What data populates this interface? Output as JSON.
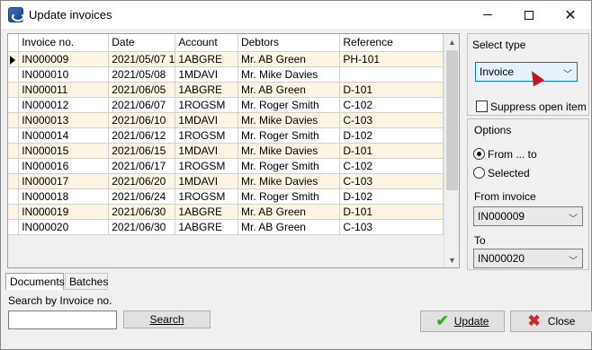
{
  "window": {
    "title": "Update invoices"
  },
  "grid": {
    "columns": [
      "Invoice no.",
      "Date",
      "Account",
      "Debtors",
      "Reference"
    ],
    "rows": [
      [
        "IN000009",
        "2021/05/07 1",
        "1ABGRE",
        "Mr. AB Green",
        "PH-101"
      ],
      [
        "IN000010",
        "2021/05/08",
        "1MDAVI",
        "Mr. Mike Davies",
        ""
      ],
      [
        "IN000011",
        "2021/06/05",
        "1ABGRE",
        "Mr. AB Green",
        "D-101"
      ],
      [
        "IN000012",
        "2021/06/07",
        "1ROGSM",
        "Mr. Roger Smith",
        "C-102"
      ],
      [
        "IN000013",
        "2021/06/10",
        "1MDAVI",
        "Mr. Mike Davies",
        "C-103"
      ],
      [
        "IN000014",
        "2021/06/12",
        "1ROGSM",
        "Mr. Roger Smith",
        "D-102"
      ],
      [
        "IN000015",
        "2021/06/15",
        "1MDAVI",
        "Mr. Mike Davies",
        "D-101"
      ],
      [
        "IN000016",
        "2021/06/17",
        "1ROGSM",
        "Mr. Roger Smith",
        "C-102"
      ],
      [
        "IN000017",
        "2021/06/20",
        "1MDAVI",
        "Mr. Mike Davies",
        "C-103"
      ],
      [
        "IN000018",
        "2021/06/24",
        "1ROGSM",
        "Mr. Roger Smith",
        "D-102"
      ],
      [
        "IN000019",
        "2021/06/30",
        "1ABGRE",
        "Mr. AB Green",
        "D-101"
      ],
      [
        "IN000020",
        "2021/06/30",
        "1ABGRE",
        "Mr. AB Green",
        "C-103"
      ]
    ]
  },
  "tabs": {
    "documents": "Documents",
    "batches": "Batches"
  },
  "search": {
    "label": "Search by Invoice no.",
    "value": "",
    "button_label": "Search"
  },
  "select_type": {
    "label": "Select type",
    "value": "Invoice",
    "suppress_label": "Suppress open item",
    "suppress_checked": false
  },
  "options": {
    "label": "Options",
    "from_to_label": "From ... to",
    "selected_label": "Selected",
    "mode": "from-to",
    "from_label": "From invoice",
    "from_value": "IN000009",
    "to_label": "To",
    "to_value": "IN000020"
  },
  "buttons": {
    "update": "Update",
    "close": "Close"
  },
  "colors": {
    "row_alt": "#fdf5e4",
    "update_icon": "#3aa82e",
    "close_icon": "#d3272c",
    "cursor": "#c7161b"
  }
}
